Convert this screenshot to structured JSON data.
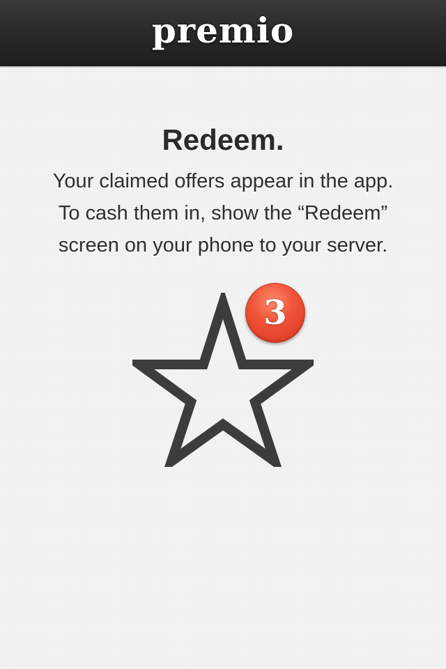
{
  "header": {
    "logo_text": "premio"
  },
  "content": {
    "title": "Redeem.",
    "body_lines": [
      "Your claimed offers appear in the app.",
      "To cash them in, show the “Redeem”",
      "screen on your phone to your server."
    ]
  },
  "badge": {
    "count": "3",
    "color": "#e84a30"
  },
  "icons": {
    "illustration": "star-outline-icon"
  },
  "colors": {
    "navbar": "#262626",
    "background": "#f1f1f1",
    "text": "#2a2a2a",
    "star_stroke": "#3c3c3c"
  }
}
